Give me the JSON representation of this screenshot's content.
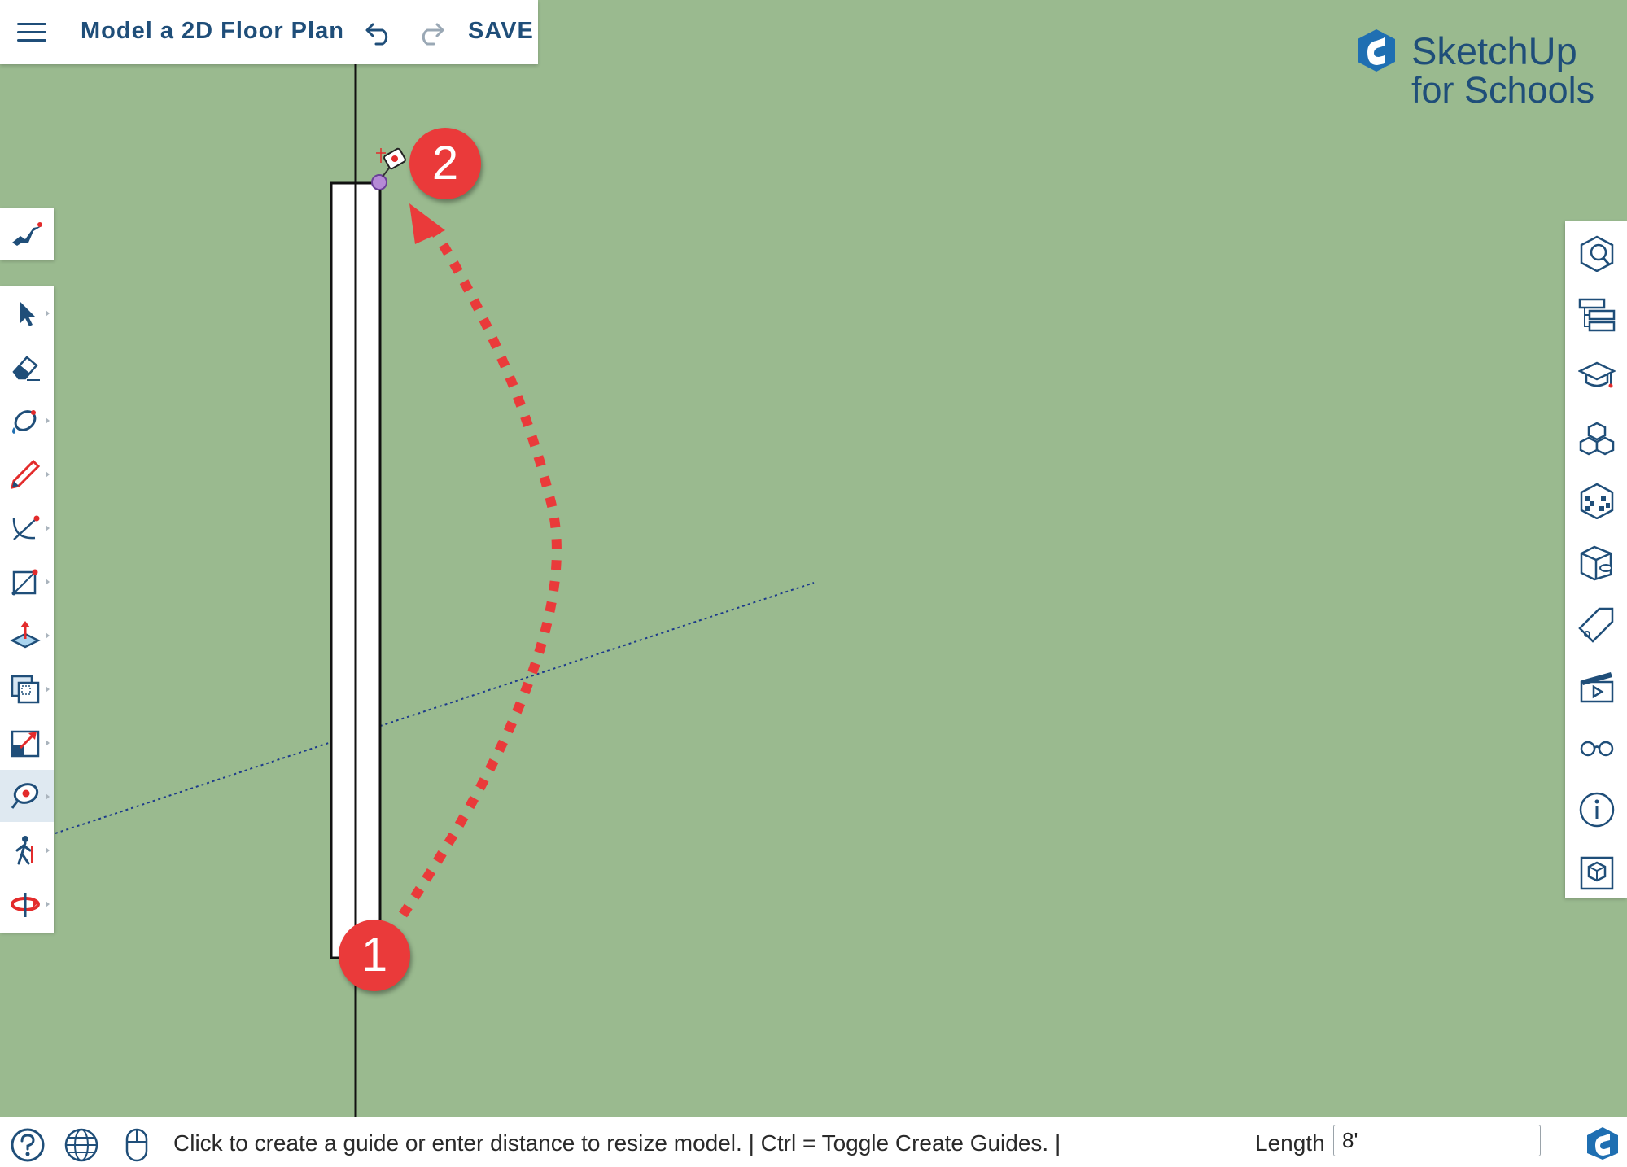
{
  "header": {
    "menu_icon": "hamburger-menu-icon",
    "document_title": "Model a 2D Floor Plan",
    "undo_icon": "undo-icon",
    "redo_icon": "redo-icon",
    "save_label": "SAVE"
  },
  "brand": {
    "name": "SketchUp",
    "subtitle": "for Schools"
  },
  "left_toolbar": {
    "instructor_tool": "instructor-icon",
    "tools": [
      {
        "name": "select-tool",
        "icon": "arrow-cursor-icon"
      },
      {
        "name": "eraser-tool",
        "icon": "eraser-icon"
      },
      {
        "name": "paint-bucket-tool",
        "icon": "paint-bucket-icon"
      },
      {
        "name": "pencil-tool",
        "icon": "pencil-icon"
      },
      {
        "name": "arc-tool",
        "icon": "arc-icon"
      },
      {
        "name": "rectangle-tool",
        "icon": "rectangle-icon"
      },
      {
        "name": "push-pull-tool",
        "icon": "push-pull-icon"
      },
      {
        "name": "offset-tool",
        "icon": "offset-icon"
      },
      {
        "name": "scale-tool",
        "icon": "scale-icon"
      },
      {
        "name": "tape-measure-tool",
        "icon": "tape-measure-icon",
        "active": true
      },
      {
        "name": "walk-tool",
        "icon": "walk-icon"
      },
      {
        "name": "orbit-tool",
        "icon": "orbit-icon"
      }
    ]
  },
  "right_panel": {
    "tools": [
      {
        "name": "search-3d-warehouse",
        "icon": "cube-search-icon"
      },
      {
        "name": "outliner",
        "icon": "outliner-icon"
      },
      {
        "name": "instructor-panel",
        "icon": "graduation-cap-icon"
      },
      {
        "name": "components-panel",
        "icon": "components-icon"
      },
      {
        "name": "materials-panel",
        "icon": "materials-cube-icon"
      },
      {
        "name": "styles-panel",
        "icon": "styles-cube-icon"
      },
      {
        "name": "tags-panel",
        "icon": "tag-icon"
      },
      {
        "name": "scenes-panel",
        "icon": "clapperboard-icon"
      },
      {
        "name": "display-panel",
        "icon": "glasses-icon"
      },
      {
        "name": "entity-info-panel",
        "icon": "info-icon"
      },
      {
        "name": "model-info-panel",
        "icon": "model-info-icon"
      }
    ]
  },
  "annotations": {
    "step1": "1",
    "step2": "2"
  },
  "status_bar": {
    "help_icon": "help-icon",
    "globe_icon": "globe-icon",
    "mouse_icon": "mouse-icon",
    "message": "Click to create a guide or enter distance to resize model. | Ctrl = Toggle Create Guides. |",
    "length_label": "Length",
    "length_value": "8'",
    "logo_icon": "sketchup-logo-icon"
  },
  "colors": {
    "canvas": "#9aba8f",
    "brand_blue": "#1f4e79",
    "annotation_red": "#ea3a3a",
    "accent_red": "#e32b2b"
  }
}
